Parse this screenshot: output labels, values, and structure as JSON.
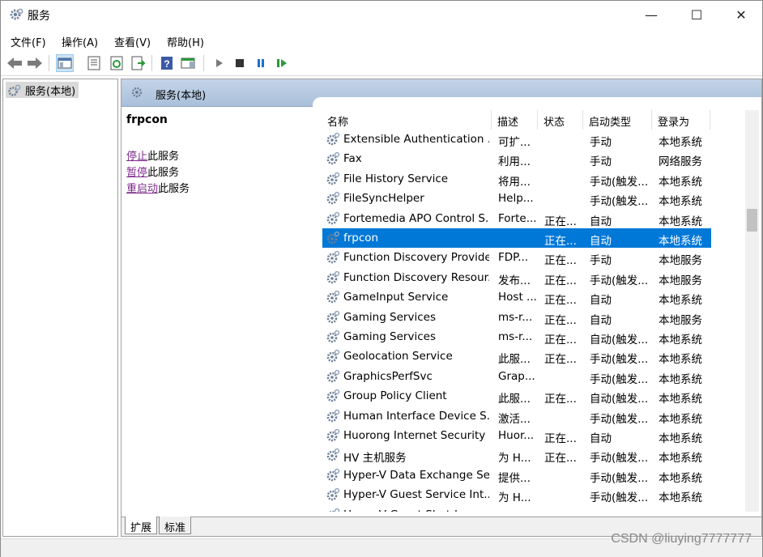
{
  "window": {
    "title": "服务",
    "controls": {
      "minimize": "—",
      "maximize": "☐",
      "close": "✕"
    }
  },
  "menu": [
    "文件(F)",
    "操作(A)",
    "查看(V)",
    "帮助(H)"
  ],
  "toolbar": {
    "icons": [
      "back-arrow-icon",
      "forward-arrow-icon",
      "show-hide-console-tree-icon",
      "properties-icon",
      "refresh-icon",
      "export-list-icon",
      "help-icon",
      "show-hide-action-pane-icon",
      "start-service-icon",
      "stop-service-icon",
      "pause-service-icon",
      "restart-service-icon"
    ]
  },
  "tree": {
    "item": "服务(本地)"
  },
  "pane": {
    "header": "服务(本地)",
    "selected_service": "frpcon",
    "actions": [
      {
        "link": "停止",
        "rest": "此服务"
      },
      {
        "link": "暂停",
        "rest": "此服务"
      },
      {
        "link": "重启动",
        "rest": "此服务"
      }
    ]
  },
  "columns": [
    "名称",
    "描述",
    "状态",
    "启动类型",
    "登录为"
  ],
  "services": [
    {
      "name": "Extensible Authentication ...",
      "desc": "可扩...",
      "status": "",
      "start": "手动",
      "logon": "本地系统"
    },
    {
      "name": "Fax",
      "desc": "利用...",
      "status": "",
      "start": "手动",
      "logon": "网络服务"
    },
    {
      "name": "File History Service",
      "desc": "将用...",
      "status": "",
      "start": "手动(触发...",
      "logon": "本地系统"
    },
    {
      "name": "FileSyncHelper",
      "desc": "Help...",
      "status": "",
      "start": "手动(触发...",
      "logon": "本地系统"
    },
    {
      "name": "Fortemedia APO Control S...",
      "desc": "Forte...",
      "status": "正在...",
      "start": "自动",
      "logon": "本地系统"
    },
    {
      "name": "frpcon",
      "desc": "",
      "status": "正在...",
      "start": "自动",
      "logon": "本地系统",
      "selected": true
    },
    {
      "name": "Function Discovery Provide...",
      "desc": "FDP...",
      "status": "正在...",
      "start": "手动",
      "logon": "本地服务"
    },
    {
      "name": "Function Discovery Resour...",
      "desc": "发布...",
      "status": "正在...",
      "start": "手动(触发...",
      "logon": "本地服务"
    },
    {
      "name": "GameInput Service",
      "desc": "Host ...",
      "status": "正在...",
      "start": "自动",
      "logon": "本地系统"
    },
    {
      "name": "Gaming Services",
      "desc": "ms-r...",
      "status": "正在...",
      "start": "自动",
      "logon": "本地服务"
    },
    {
      "name": "Gaming Services",
      "desc": "ms-r...",
      "status": "正在...",
      "start": "自动(触发...",
      "logon": "本地系统"
    },
    {
      "name": "Geolocation Service",
      "desc": "此服...",
      "status": "正在...",
      "start": "手动(触发...",
      "logon": "本地系统"
    },
    {
      "name": "GraphicsPerfSvc",
      "desc": "Grap...",
      "status": "",
      "start": "手动(触发...",
      "logon": "本地系统"
    },
    {
      "name": "Group Policy Client",
      "desc": "此服...",
      "status": "正在...",
      "start": "自动(触发...",
      "logon": "本地系统"
    },
    {
      "name": "Human Interface Device S...",
      "desc": "激活...",
      "status": "",
      "start": "手动(触发...",
      "logon": "本地系统"
    },
    {
      "name": "Huorong Internet Security ...",
      "desc": "Huor...",
      "status": "正在...",
      "start": "自动",
      "logon": "本地系统"
    },
    {
      "name": "HV 主机服务",
      "desc": "为 H...",
      "status": "正在...",
      "start": "手动(触发...",
      "logon": "本地系统"
    },
    {
      "name": "Hyper-V Data Exchange Se...",
      "desc": "提供...",
      "status": "",
      "start": "手动(触发...",
      "logon": "本地系统"
    },
    {
      "name": "Hyper-V Guest Service Int...",
      "desc": "为 H...",
      "status": "",
      "start": "手动(触发...",
      "logon": "本地系统"
    },
    {
      "name": "Hyper-V Guest Shutdown ...",
      "desc": "提供...",
      "status": "",
      "start": "手动(触发...",
      "logon": "本地系统"
    }
  ],
  "tabs": [
    "扩展",
    "标准"
  ],
  "watermark": "CSDN @liuying7777777",
  "colors": {
    "selection": "#0078d7",
    "header_band": "#b4c8df",
    "link": "#7d2b8b"
  }
}
